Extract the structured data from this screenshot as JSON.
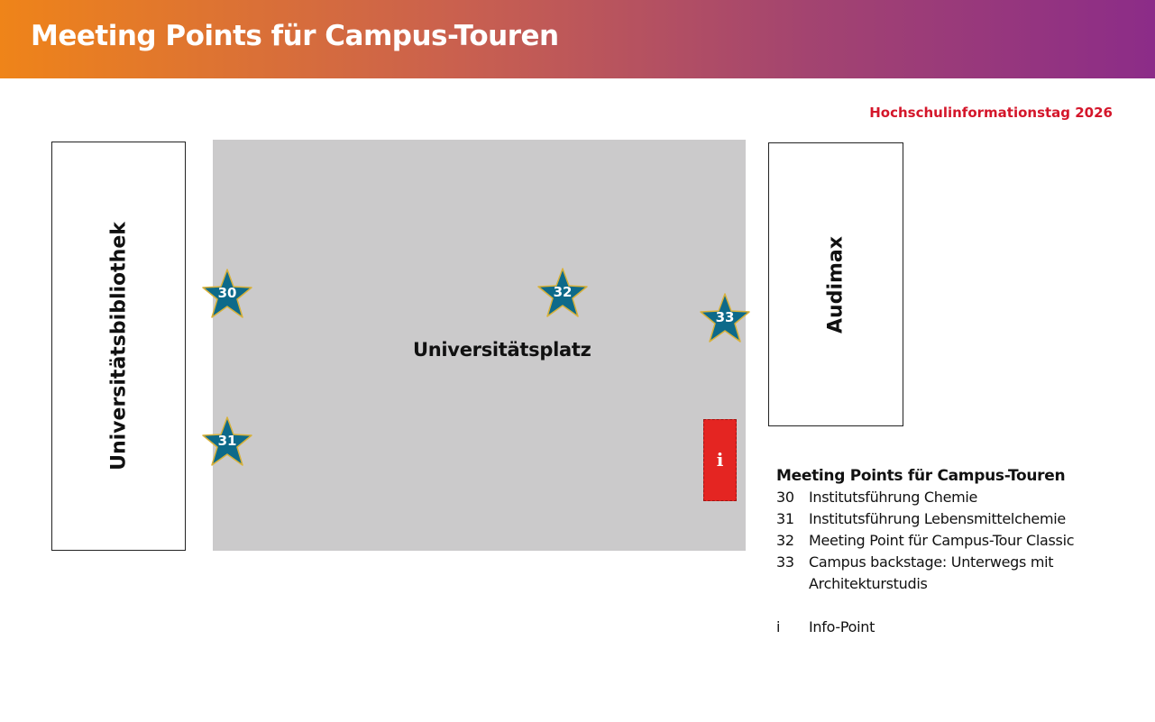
{
  "header": {
    "title": "Meeting Points für Campus-Touren"
  },
  "event_label": "Hochschulinformationstag 2026",
  "buildings": {
    "library": "Universitätsbibliothek",
    "audimax": "Audimax"
  },
  "plaza": {
    "label": "Universitätsplatz"
  },
  "markers": {
    "m30": "30",
    "m31": "31",
    "m32": "32",
    "m33": "33",
    "info": "i"
  },
  "legend": {
    "title": "Meeting Points für Campus-Touren",
    "items": [
      {
        "num": "30",
        "text": "Institutsführung Chemie"
      },
      {
        "num": "31",
        "text": "Institutsführung Lebensmittelchemie"
      },
      {
        "num": "32",
        "text": "Meeting Point für Campus-Tour Classic"
      },
      {
        "num": "33",
        "text": "Campus backstage: Unterwegs mit Architekturstudis"
      },
      {
        "num": "i",
        "text": "Info-Point"
      }
    ]
  },
  "colors": {
    "header_gradient_start": "#ef8419",
    "header_gradient_end": "#8c2c88",
    "accent_red": "#d4162a",
    "plaza_gray": "#cbcacb",
    "star_fill": "#0d6a8a",
    "star_outline": "#d8b13a",
    "info_red": "#e42522"
  },
  "icons": {
    "meeting_point": "star-icon",
    "info_point": "info-icon"
  }
}
